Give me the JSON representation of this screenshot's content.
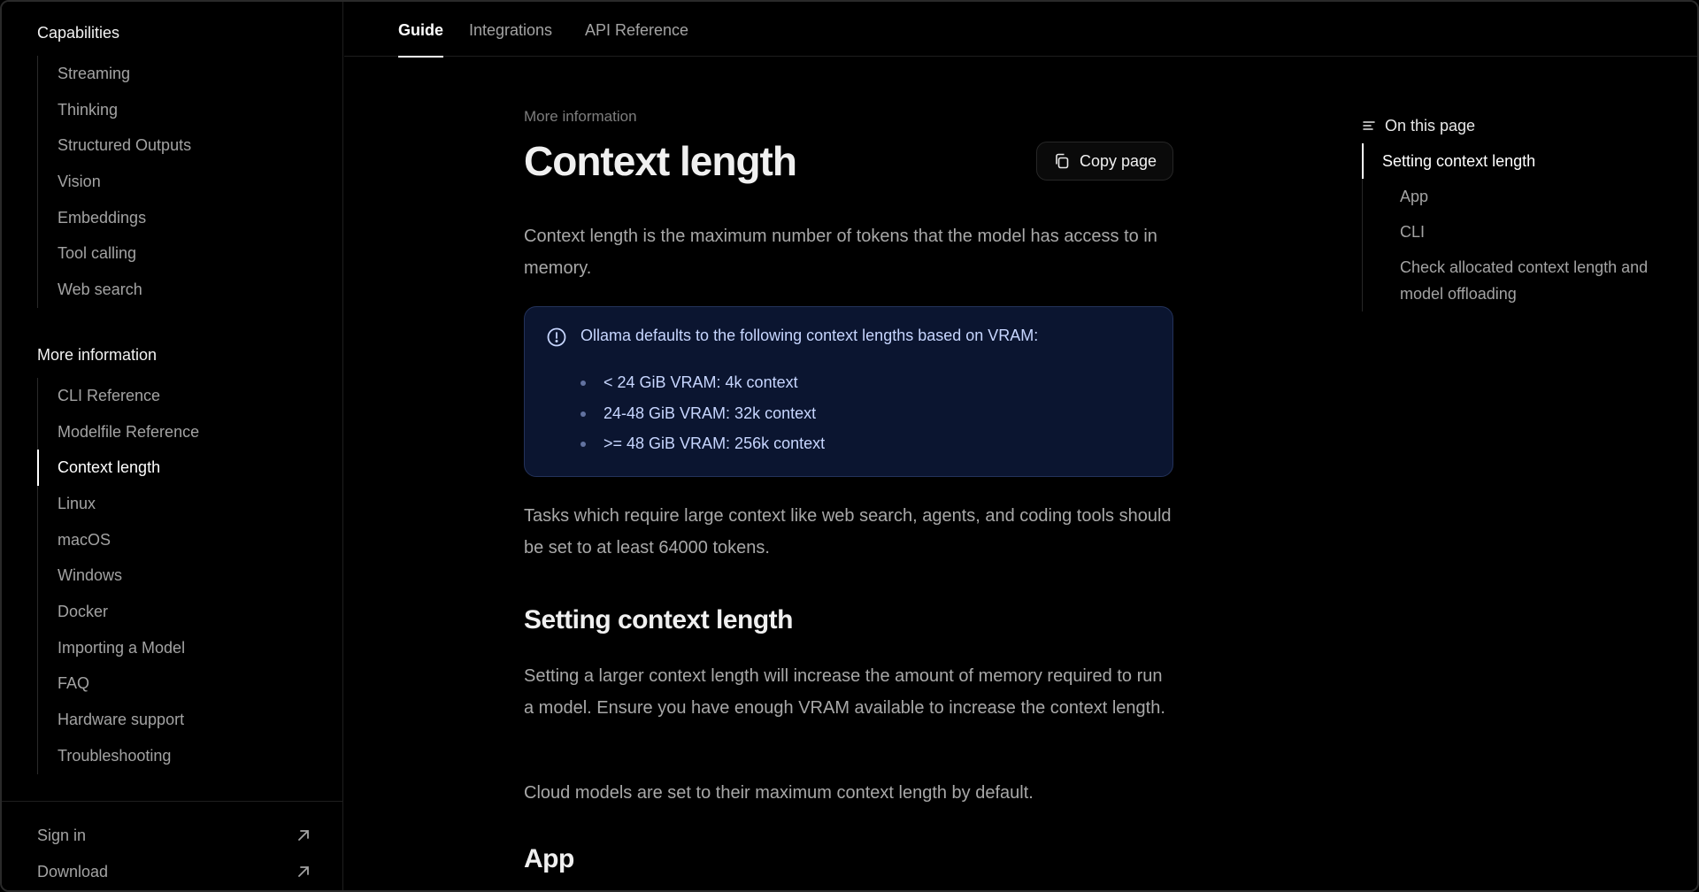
{
  "sidebar": {
    "capabilities": {
      "title": "Capabilities",
      "items": [
        {
          "label": "Streaming"
        },
        {
          "label": "Thinking"
        },
        {
          "label": "Structured Outputs"
        },
        {
          "label": "Vision"
        },
        {
          "label": "Embeddings"
        },
        {
          "label": "Tool calling"
        },
        {
          "label": "Web search"
        }
      ]
    },
    "more_information": {
      "title": "More information",
      "items": [
        {
          "label": "CLI Reference"
        },
        {
          "label": "Modelfile Reference"
        },
        {
          "label": "Context length",
          "active": true
        },
        {
          "label": "Linux"
        },
        {
          "label": "macOS"
        },
        {
          "label": "Windows"
        },
        {
          "label": "Docker"
        },
        {
          "label": "Importing a Model"
        },
        {
          "label": "FAQ"
        },
        {
          "label": "Hardware support"
        },
        {
          "label": "Troubleshooting"
        }
      ]
    },
    "footer": {
      "sign_in": "Sign in",
      "download": "Download"
    }
  },
  "tabs": [
    {
      "label": "Guide",
      "active": true
    },
    {
      "label": "Integrations"
    },
    {
      "label": "API Reference"
    }
  ],
  "main": {
    "eyebrow": "More information",
    "title": "Context length",
    "copy_button": "Copy page",
    "intro": "Context length is the maximum number of tokens that the model has access to in memory.",
    "callout": {
      "text": "Ollama defaults to the following context lengths based on VRAM:",
      "items": [
        "< 24 GiB VRAM: 4k context",
        "24-48 GiB VRAM: 32k context",
        ">= 48 GiB VRAM: 256k context"
      ]
    },
    "tasks_para": "Tasks which require large context like web search, agents, and coding tools should be set to at least 64000 tokens.",
    "section_heading": "Setting context length",
    "setting_para": "Setting a larger context length will increase the amount of memory required to run a model. Ensure you have enough VRAM available to increase the context length.",
    "cloud_para": "Cloud models are set to their maximum context length by default.",
    "app_heading": "App"
  },
  "toc": {
    "title": "On this page",
    "items": [
      {
        "label": "Setting context length",
        "active": true
      },
      {
        "label": "App"
      },
      {
        "label": "CLI"
      },
      {
        "label": "Check allocated context length and model offloading"
      }
    ]
  },
  "icons": {
    "callout": "info-circle-icon",
    "copy": "copy-icon",
    "toc": "list-icon",
    "external": "arrow-up-right-icon"
  },
  "colors": {
    "background": "#000000",
    "callout_bg": "#0b1530",
    "callout_text": "#c7d6ff",
    "accent": "#ffffff"
  }
}
